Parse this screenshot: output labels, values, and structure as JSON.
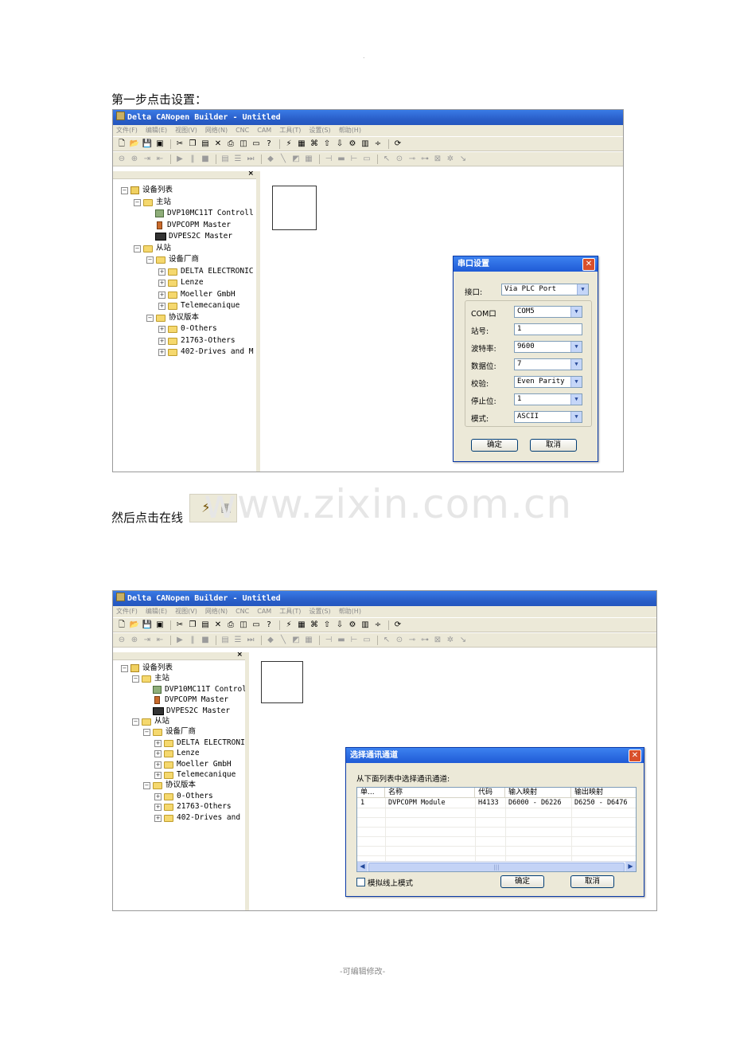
{
  "doc": {
    "step1": "第一步点击设置：",
    "step2": "然后点击在线",
    "watermark": "www.zixin.com.cn",
    "footer": "-可编辑修改-",
    "top_dot": "."
  },
  "app": {
    "title": "Delta CANopen Builder - Untitled",
    "menu": [
      "文件(F)",
      "编辑(E)",
      "视图(V)",
      "网络(N)",
      "CNC",
      "CAM",
      "工具(T)",
      "设置(S)",
      "帮助(H)"
    ],
    "tree": {
      "close": "×",
      "root": "设备列表",
      "master_group": "主站",
      "masters": [
        "DVP10MC11T Controll",
        "DVPCOPM Master",
        "DVPES2C Master"
      ],
      "slave_group": "从站",
      "vendor_group": "设备厂商",
      "vendors": [
        "DELTA ELECTRONIC",
        "Lenze",
        "Moeller GmbH",
        "Telemecanique"
      ],
      "protocol_group": "协议版本",
      "protocols": [
        "0-Others",
        "21763-Others",
        "402-Drives and M"
      ]
    }
  },
  "serial_dialog": {
    "title": "串口设置",
    "port_label": "接口:",
    "port_value": "Via PLC Port",
    "fields": [
      {
        "label": "COM口",
        "value": "COM5"
      },
      {
        "label": "站号:",
        "value": "1"
      },
      {
        "label": "波特率:",
        "value": "9600"
      },
      {
        "label": "数据位:",
        "value": "7"
      },
      {
        "label": "校验:",
        "value": "Even Parity"
      },
      {
        "label": "停止位:",
        "value": "1"
      },
      {
        "label": "模式:",
        "value": "ASCII"
      }
    ],
    "ok": "确定",
    "cancel": "取消"
  },
  "channel_dialog": {
    "title": "选择通讯通道",
    "prompt": "从下面列表中选择通讯通道:",
    "columns": [
      "单...",
      "名称",
      "代码",
      "输入映射",
      "输出映射"
    ],
    "rows": [
      [
        "1",
        "DVPCOPM Module",
        "H4133",
        "D6000 - D6226",
        "D6250 - D6476"
      ]
    ],
    "scroll_mark": "|||",
    "simulate": "模拟线上模式",
    "ok": "确定",
    "cancel": "取消"
  }
}
